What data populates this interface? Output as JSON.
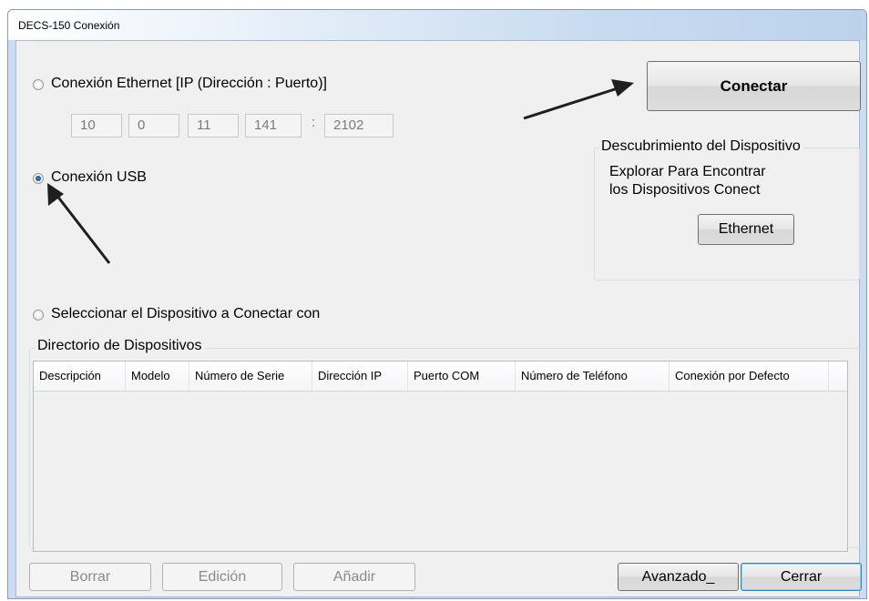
{
  "window": {
    "title": "DECS-150 Conexión"
  },
  "ethernet": {
    "label": "Conexión Ethernet [IP (Dirección : Puerto)]",
    "selected": false,
    "ip": [
      "10",
      "0",
      "11",
      "141"
    ],
    "separator": ":",
    "port": "2102"
  },
  "usb": {
    "label": "Conexión USB",
    "selected": true
  },
  "select_device": {
    "label": "Seleccionar el Dispositivo a Conectar con",
    "selected": false
  },
  "connect_button": {
    "label": "Conectar"
  },
  "discovery": {
    "title": "Descubrimiento del Dispositivo",
    "line1": "Explorar Para Encontrar",
    "line2": "los Dispositivos Conect",
    "button": "Ethernet"
  },
  "directory": {
    "title": "Directorio de Dispositivos",
    "columns": [
      "Descripción",
      "Modelo",
      "Número de Serie",
      "Dirección IP",
      "Puerto COM",
      "Número de Teléfono",
      "Conexión por Defecto"
    ],
    "rows": []
  },
  "footer": {
    "delete": "Borrar",
    "edit": "Edición",
    "add": "Añadir",
    "advanced": "Avanzado_",
    "close": "Cerrar"
  },
  "colors": {
    "arrow": "#1f1f1f",
    "title_gradient_end": "#bcd2ec",
    "dialog_bg": "#f0f0f0"
  }
}
